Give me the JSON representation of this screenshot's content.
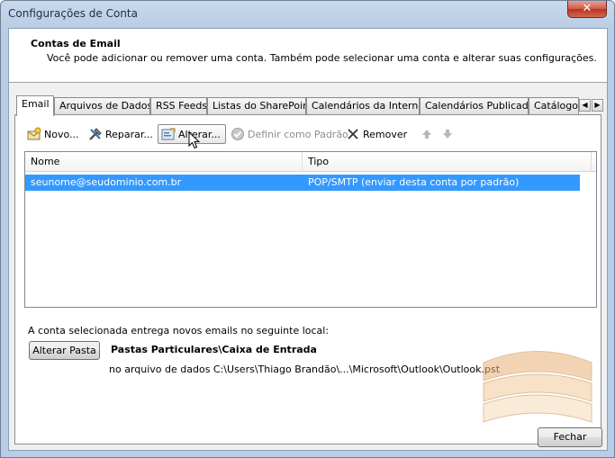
{
  "window": {
    "title": "Configurações de Conta",
    "close_label": "✕"
  },
  "header": {
    "title": "Contas de Email",
    "description": "Você pode adicionar ou remover uma conta. Também pode selecionar uma conta e alterar suas configurações."
  },
  "tabs": [
    {
      "label": "Email",
      "active": true
    },
    {
      "label": "Arquivos de Dados"
    },
    {
      "label": "RSS Feeds"
    },
    {
      "label": "Listas do SharePoint"
    },
    {
      "label": "Calendários da Internet"
    },
    {
      "label": "Calendários Publicados"
    },
    {
      "label": "Catálogos"
    }
  ],
  "toolbar": {
    "new_label": "Novo...",
    "repair_label": "Reparar...",
    "change_label": "Alterar...",
    "default_label": "Definir como Padrão",
    "remove_label": "Remover"
  },
  "list": {
    "columns": [
      "Nome",
      "Tipo"
    ],
    "rows": [
      {
        "name": "seunome@seudominio.com.br",
        "type": "POP/SMTP (enviar desta conta por padrão)",
        "selected": true
      }
    ]
  },
  "delivery": {
    "label": "A conta selecionada entrega novos emails no seguinte local:",
    "change_folder_label": "Alterar Pasta",
    "folder": "Pastas Particulares\\Caixa de Entrada",
    "data_file": "no arquivo de dados C:\\Users\\Thiago Brandão\\...\\Microsoft\\Outlook\\Outlook.pst"
  },
  "footer": {
    "close_label": "Fechar"
  },
  "colors": {
    "selection": "#3399ff",
    "title_bar": "#b9cde5",
    "close_button": "#c9462c"
  }
}
